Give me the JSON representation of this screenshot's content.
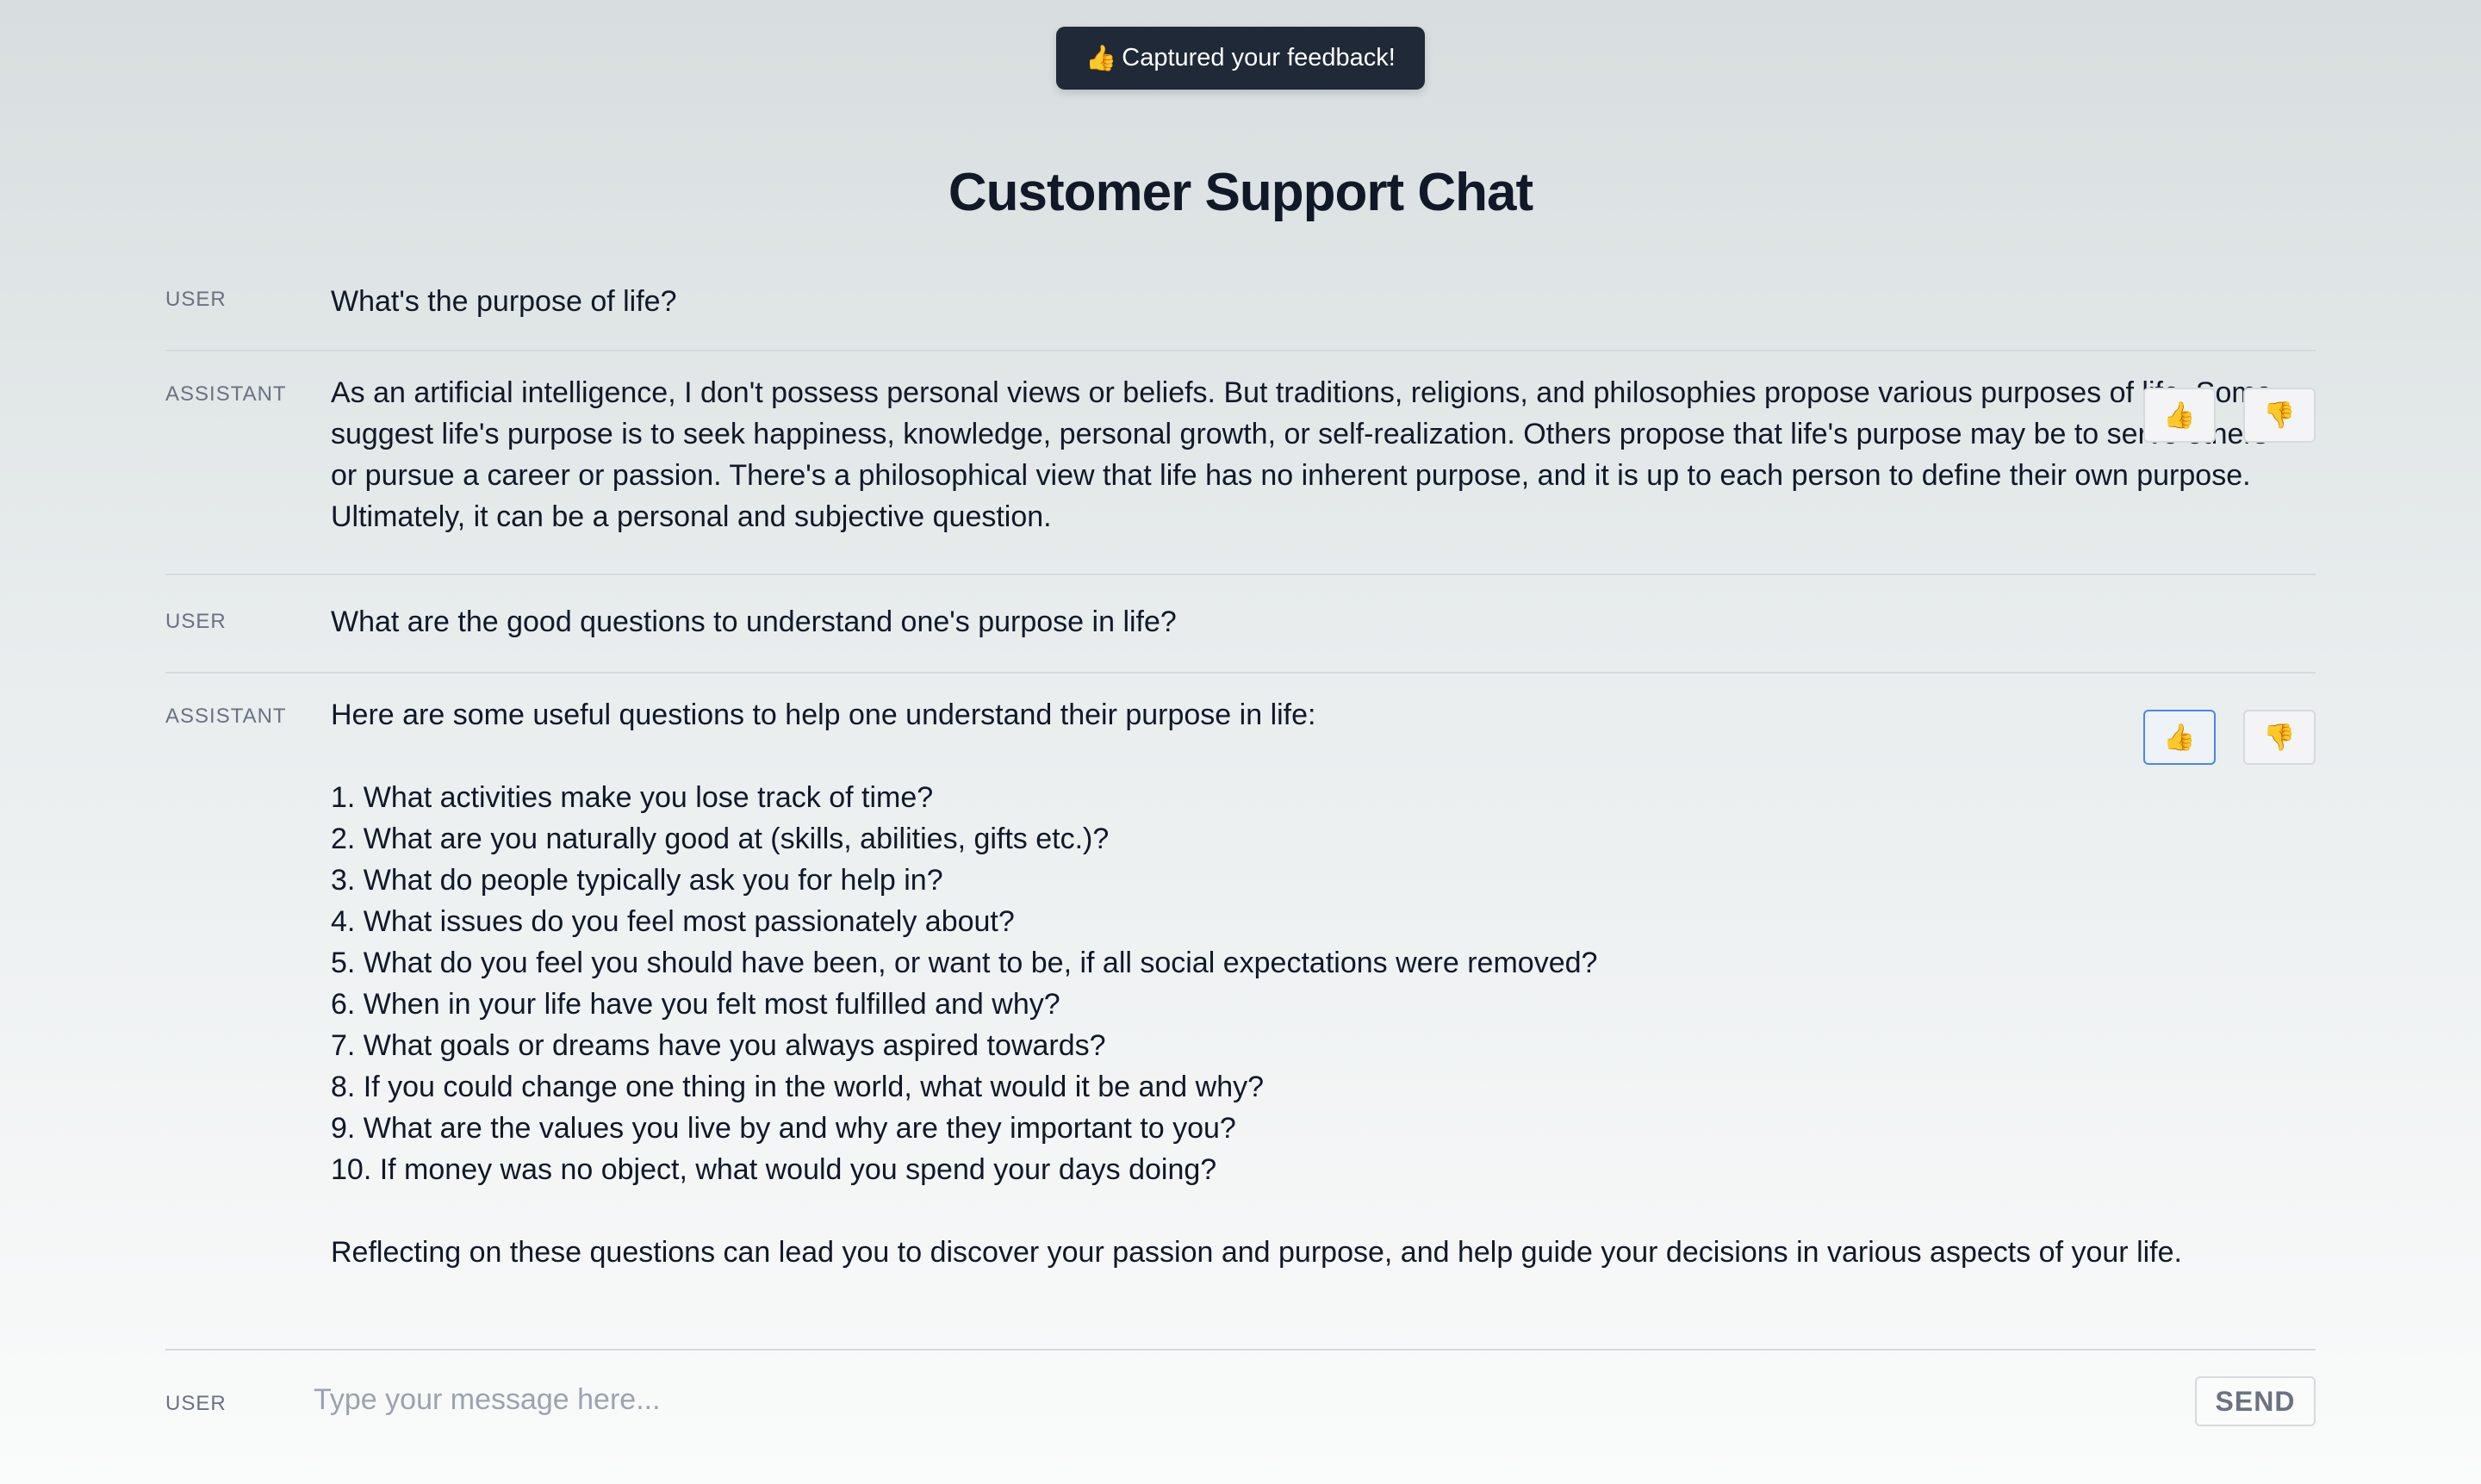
{
  "toast": {
    "icon": "👍",
    "text": "Captured your feedback!"
  },
  "page_title": "Customer Support Chat",
  "messages": [
    {
      "role": "USER",
      "text": "What's the purpose of life?"
    },
    {
      "role": "ASSISTANT",
      "text": "As an artificial intelligence, I don't possess personal views or beliefs. But traditions, religions, and philosophies propose various purposes of life. Some suggest life's purpose is to seek happiness, knowledge, personal growth, or self-realization. Others propose that life's purpose may be to serve others or pursue a career or passion. There's a philosophical view that life has no inherent purpose, and it is up to each person to define their own purpose. Ultimately, it can be a personal and subjective question.",
      "thumbs_up": "👍",
      "thumbs_down": "👎",
      "selected_feedback": "none"
    },
    {
      "role": "USER",
      "text": "What are the good questions to understand one's purpose in life?"
    },
    {
      "role": "ASSISTANT",
      "text": "Here are some useful questions to help one understand their purpose in life:\n\n1. What activities make you lose track of time?\n2. What are you naturally good at (skills, abilities, gifts etc.)?\n3. What do people typically ask you for help in?\n4. What issues do you feel most passionately about?\n5. What do you feel you should have been, or want to be, if all social expectations were removed?\n6. When in your life have you felt most fulfilled and why?\n7. What goals or dreams have you always aspired towards?\n8. If you could change one thing in the world, what would it be and why?\n9. What are the values you live by and why are they important to you?\n10. If money was no object, what would you spend your days doing?\n\nReflecting on these questions can lead you to discover your passion and purpose, and help guide your decisions in various aspects of your life.",
      "thumbs_up": "👍",
      "thumbs_down": "👎",
      "selected_feedback": "up"
    }
  ],
  "composer": {
    "role": "USER",
    "placeholder": "Type your message here...",
    "value": "",
    "send_label": "SEND"
  }
}
